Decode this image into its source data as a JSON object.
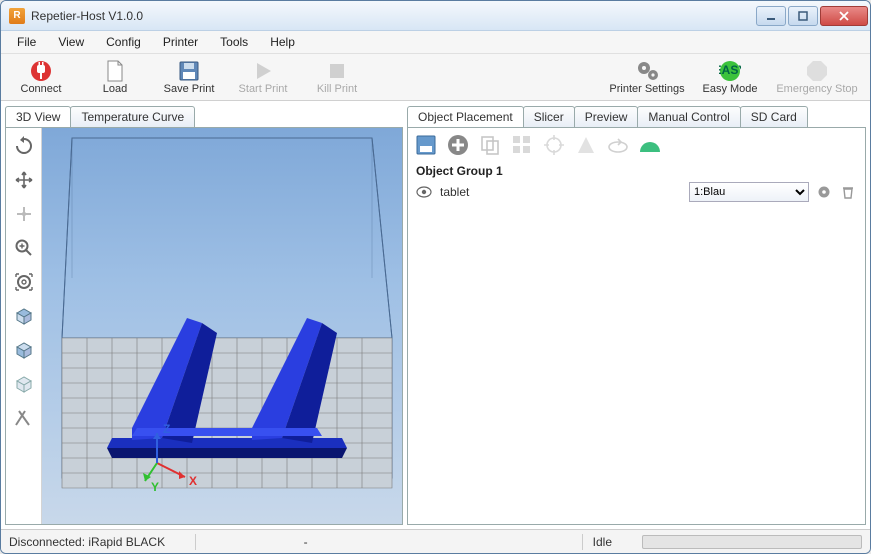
{
  "window": {
    "title": "Repetier-Host V1.0.0"
  },
  "menu": {
    "items": [
      "File",
      "View",
      "Config",
      "Printer",
      "Tools",
      "Help"
    ]
  },
  "toolbar": {
    "connect": "Connect",
    "load": "Load",
    "save_print": "Save Print",
    "start_print": "Start Print",
    "kill_print": "Kill Print",
    "printer_settings": "Printer Settings",
    "easy_mode": "Easy Mode",
    "emergency_stop": "Emergency Stop"
  },
  "left_tabs": {
    "view3d": "3D View",
    "temp_curve": "Temperature Curve"
  },
  "right_tabs": {
    "object_placement": "Object Placement",
    "slicer": "Slicer",
    "preview": "Preview",
    "manual_control": "Manual Control",
    "sd_card": "SD Card"
  },
  "object_panel": {
    "group_label": "Object Group 1",
    "rows": [
      {
        "name": "tablet",
        "extruder_selected": "1:Blau",
        "extruder_options": [
          "1:Blau"
        ]
      }
    ]
  },
  "status": {
    "connection": "Disconnected: iRapid BLACK",
    "coord": "-",
    "state": "Idle"
  },
  "axes": {
    "x": "X",
    "y": "Y",
    "z": "Z"
  }
}
